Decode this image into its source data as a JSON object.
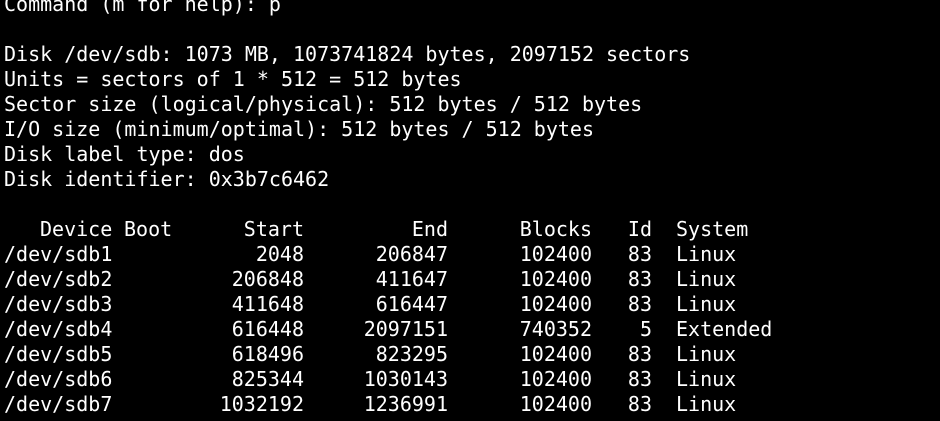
{
  "terminal": {
    "prompt": "Command (m for help): p",
    "info": [
      "Disk /dev/sdb: 1073 MB, 1073741824 bytes, 2097152 sectors",
      "Units = sectors of 1 * 512 = 512 bytes",
      "Sector size (logical/physical): 512 bytes / 512 bytes",
      "I/O size (minimum/optimal): 512 bytes / 512 bytes",
      "Disk label type: dos",
      "Disk identifier: 0x3b7c6462"
    ],
    "table": {
      "headers": {
        "device": "Device",
        "boot": "Boot",
        "start": "Start",
        "end": "End",
        "blocks": "Blocks",
        "id": "Id",
        "system": "System"
      },
      "rows": [
        {
          "device": "/dev/sdb1",
          "boot": "",
          "start": "2048",
          "end": "206847",
          "blocks": "102400",
          "id": "83",
          "system": "Linux"
        },
        {
          "device": "/dev/sdb2",
          "boot": "",
          "start": "206848",
          "end": "411647",
          "blocks": "102400",
          "id": "83",
          "system": "Linux"
        },
        {
          "device": "/dev/sdb3",
          "boot": "",
          "start": "411648",
          "end": "616447",
          "blocks": "102400",
          "id": "83",
          "system": "Linux"
        },
        {
          "device": "/dev/sdb4",
          "boot": "",
          "start": "616448",
          "end": "2097151",
          "blocks": "740352",
          "id": "5",
          "system": "Extended"
        },
        {
          "device": "/dev/sdb5",
          "boot": "",
          "start": "618496",
          "end": "823295",
          "blocks": "102400",
          "id": "83",
          "system": "Linux"
        },
        {
          "device": "/dev/sdb6",
          "boot": "",
          "start": "825344",
          "end": "1030143",
          "blocks": "102400",
          "id": "83",
          "system": "Linux"
        },
        {
          "device": "/dev/sdb7",
          "boot": "",
          "start": "1032192",
          "end": "1236991",
          "blocks": "102400",
          "id": "83",
          "system": "Linux"
        }
      ]
    }
  }
}
